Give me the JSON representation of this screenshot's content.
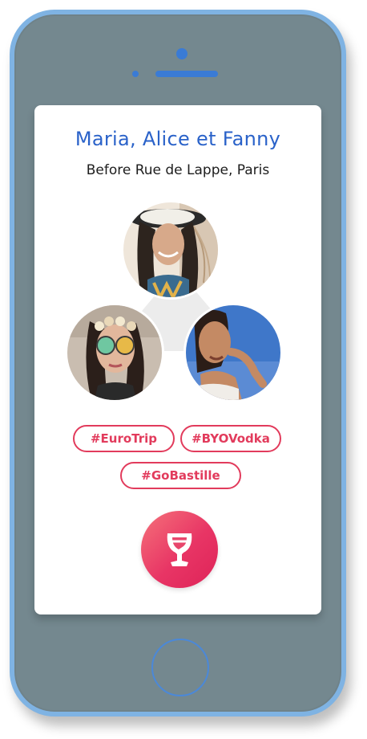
{
  "card": {
    "title": "Maria, Alice et Fanny",
    "subtitle": "Before Rue de Lappe, Paris"
  },
  "avatars": [
    {
      "name": "avatar-1",
      "icon": "person-photo"
    },
    {
      "name": "avatar-2",
      "icon": "person-photo"
    },
    {
      "name": "avatar-3",
      "icon": "person-photo"
    }
  ],
  "tags": [
    "#EuroTrip",
    "#BYOVodka",
    "#GoBastille"
  ],
  "cta": {
    "icon": "wine-glass-icon"
  },
  "colors": {
    "accent": "#2a62c9",
    "tag": "#e23b5c",
    "phone_body": "#74888f",
    "phone_frame": "#7fb3e3",
    "cta_gradient_start": "#f5727a",
    "cta_gradient_end": "#de2358"
  }
}
